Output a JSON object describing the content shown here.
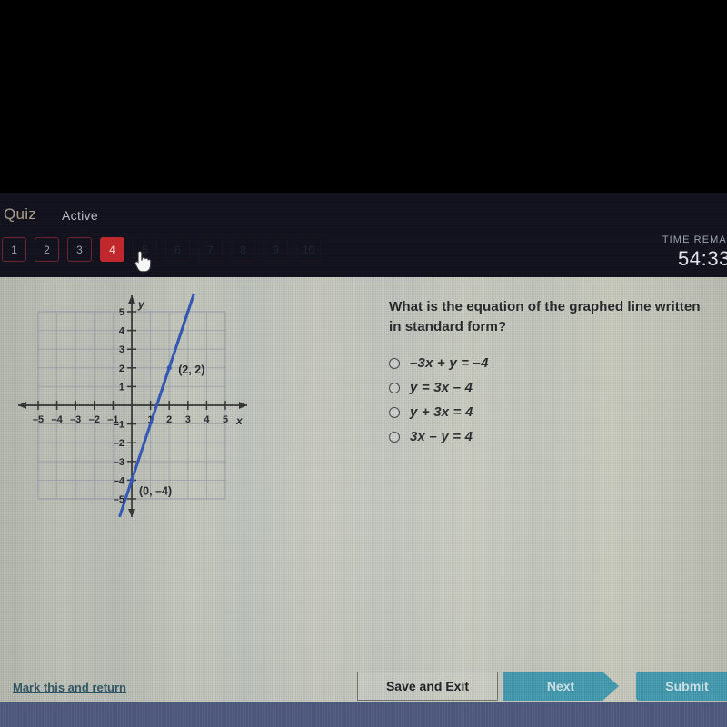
{
  "header": {
    "quiz_label": "Quiz",
    "state_label": "Active",
    "timer_label": "TIME REMAI",
    "timer_value": "54:33",
    "tabs": [
      {
        "label": "1",
        "active": false,
        "dim": false
      },
      {
        "label": "2",
        "active": false,
        "dim": false
      },
      {
        "label": "3",
        "active": false,
        "dim": false
      },
      {
        "label": "4",
        "active": true,
        "dim": false
      },
      {
        "label": "5",
        "active": false,
        "dim": true
      },
      {
        "label": "6",
        "active": false,
        "dim": true
      },
      {
        "label": "7",
        "active": false,
        "dim": true
      },
      {
        "label": "8",
        "active": false,
        "dim": true
      },
      {
        "label": "9",
        "active": false,
        "dim": true
      },
      {
        "label": "10",
        "active": false,
        "dim": true
      }
    ],
    "active_tab_color": "#c0282d",
    "cursor_icon": "pointing-hand-cursor"
  },
  "question": {
    "text": "What is the equation of the graphed line written in standard form?",
    "options": [
      {
        "id": "a",
        "label": "–3x + y = –4",
        "selected": false
      },
      {
        "id": "b",
        "label": "y = 3x – 4",
        "selected": false
      },
      {
        "id": "c",
        "label": "y + 3x = 4",
        "selected": false
      },
      {
        "id": "d",
        "label": "3x – y = 4",
        "selected": false
      }
    ]
  },
  "chart_data": {
    "type": "line",
    "title": "",
    "xlabel": "x",
    "ylabel": "y",
    "xlim": [
      -5.5,
      5.5
    ],
    "ylim": [
      -5.5,
      5.5
    ],
    "xticks": [
      -5,
      -4,
      -3,
      -2,
      -1,
      1,
      2,
      3,
      4,
      5
    ],
    "yticks": [
      -5,
      -4,
      -3,
      -2,
      -1,
      1,
      2,
      3,
      4,
      5
    ],
    "xtick_labels": [
      "–5",
      "–4",
      "–3",
      "–2",
      "–1",
      "1",
      "2",
      "3",
      "4",
      "5"
    ],
    "ytick_labels": [
      "–5",
      "–4",
      "–3",
      "–2",
      "–1",
      "1",
      "2",
      "3",
      "4",
      "5"
    ],
    "grid": true,
    "line_color": "#2b52b5",
    "series": [
      {
        "name": "graphed line",
        "equation": "y = 3x - 4",
        "slope": 3,
        "intercept": -4,
        "points": [
          [
            0,
            -4
          ],
          [
            2,
            2
          ]
        ]
      }
    ],
    "annotations": [
      {
        "text": "(2, 2)",
        "x": 2,
        "y": 2
      },
      {
        "text": "(0, –4)",
        "x": 0,
        "y": -4
      }
    ]
  },
  "bottom": {
    "mark_link": "Mark this and return",
    "save_label": "Save and Exit",
    "next_label": "Next",
    "submit_label": "Submit",
    "accent_teal": "#3f98ae"
  }
}
